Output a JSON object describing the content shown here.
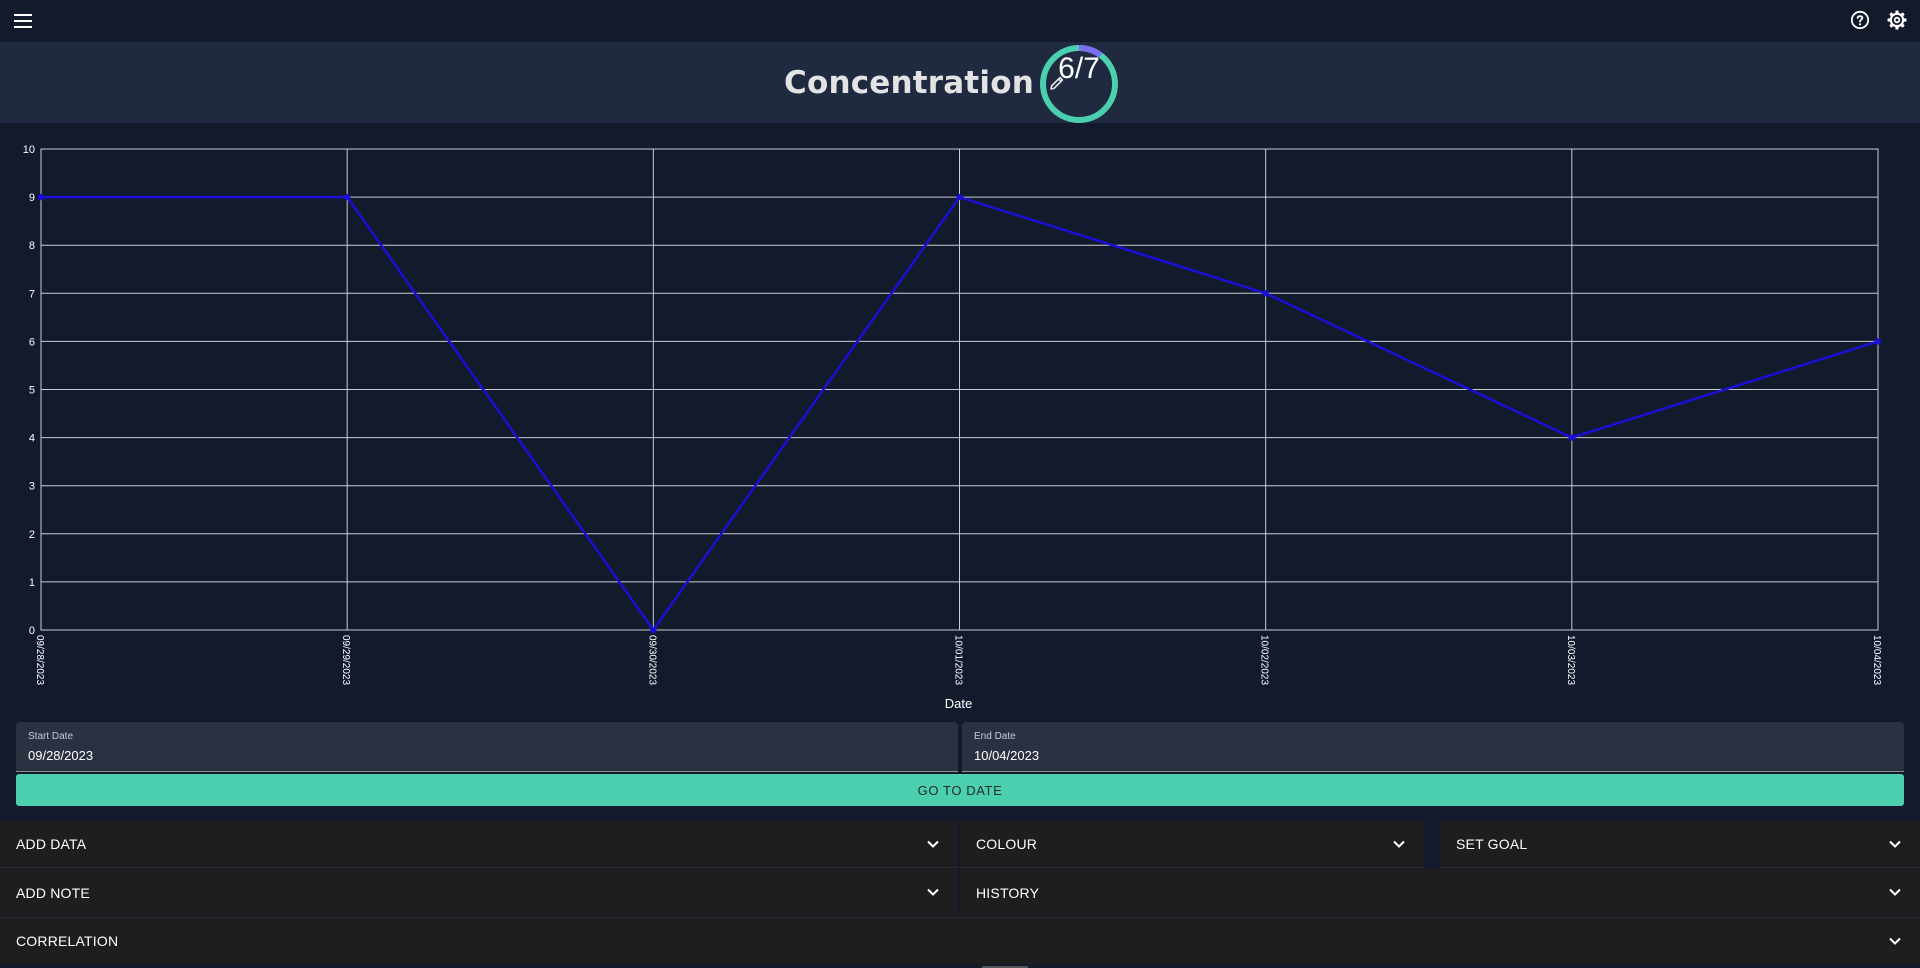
{
  "header": {
    "title": "Concentration",
    "progress_text": "6/7",
    "progress_fraction": 0.857
  },
  "icons": {
    "menu": "menu-icon",
    "help": "help-circle-icon",
    "settings": "gear-icon",
    "edit": "pencil-icon",
    "expand": "chevron-down-icon"
  },
  "colors": {
    "line": "#1a0fd6",
    "accent": "#4ccfae",
    "ring_track": "#4ccfae",
    "ring_fill": "#7b6ff0"
  },
  "chart_data": {
    "type": "line",
    "x": [
      "09/28/2023",
      "09/29/2023",
      "09/30/2023",
      "10/01/2023",
      "10/02/2023",
      "10/03/2023",
      "10/04/2023"
    ],
    "series": [
      {
        "values": [
          9,
          9,
          0,
          9,
          7,
          4,
          6
        ]
      }
    ],
    "xlabel": "Date",
    "ylabel": "",
    "ylim": [
      0,
      10
    ],
    "yticks": [
      "0",
      "1",
      "2",
      "3",
      "4",
      "5",
      "6",
      "7",
      "8",
      "9",
      "10"
    ],
    "grid": true
  },
  "date_range": {
    "start_label": "Start Date",
    "start_value": "09/28/2023",
    "end_label": "End Date",
    "end_value": "10/04/2023",
    "go_label": "GO TO DATE"
  },
  "panels": {
    "add_data": "ADD DATA",
    "colour": "COLOUR",
    "set_goal": "SET GOAL",
    "add_note": "ADD NOTE",
    "history": "HISTORY",
    "correlation": "CORRELATION"
  }
}
